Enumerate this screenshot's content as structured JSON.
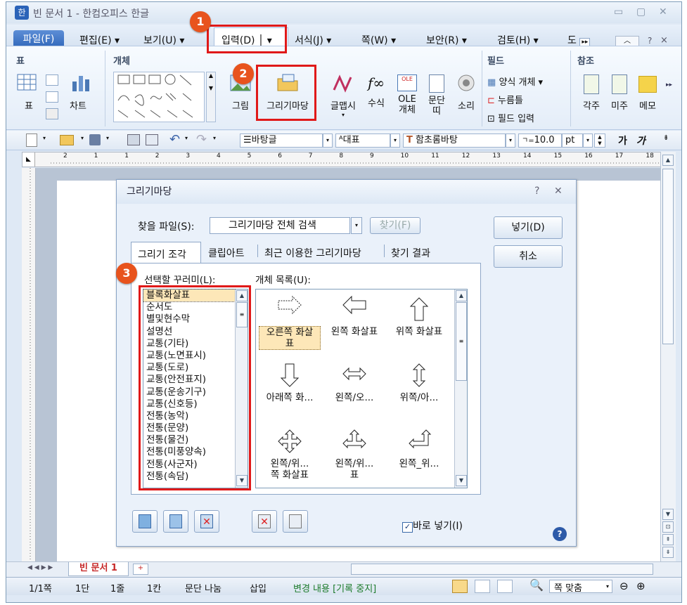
{
  "window": {
    "title": "빈 문서 1 - 한컴오피스 한글",
    "app_icon": "한",
    "min": "▭",
    "max": "▢",
    "close": "✕"
  },
  "menus": [
    "파일(F)",
    "편집(E)",
    "보기(U)",
    "입력(D)",
    "서식(J)",
    "쪽(W)",
    "보안(R)",
    "검토(H)",
    "도"
  ],
  "menu_extra": {
    "help": "?",
    "close": "×"
  },
  "ribbon": {
    "groups": {
      "table": "표",
      "object": "개체",
      "field": "필드",
      "ref": "참조"
    },
    "buttons": {
      "table": "표",
      "chart": "차트",
      "picture": "그림",
      "gallery": "그리기마당",
      "textart": "글맵시",
      "equation": "수식",
      "ole": "OLE\n개체",
      "char": "문단\n띠",
      "sound": "소리",
      "form": "양식 개체",
      "clickhere": "누름틀",
      "fieldinput": "필드 입력",
      "footnote": "각주",
      "endnote": "미주",
      "memo": "메모"
    }
  },
  "toolbar2": {
    "style": "바탕글",
    "langstyle": "대표",
    "font": "함초롬바탕",
    "size": "10.0",
    "unit": "pt",
    "bold": "가",
    "italic": "가"
  },
  "ruler_marks": [
    "2",
    "1",
    "1",
    "2",
    "3",
    "4",
    "5",
    "6",
    "7",
    "8",
    "9",
    "10",
    "11",
    "12",
    "13",
    "14",
    "15",
    "16",
    "17",
    "18"
  ],
  "dialog": {
    "title": "그리기마당",
    "help": "?",
    "close": "✕",
    "find_label": "찾을 파일(S):",
    "find_value": "그리기마당 전체 검색",
    "find_button": "찾기(F)",
    "insert_button": "넣기(D)",
    "cancel_button": "취소",
    "tabs": [
      "그리기 조각",
      "클립아트",
      "최근 이용한 그리기마당",
      "찾기 결과"
    ],
    "category_label": "선택할 꾸러미(L):",
    "objects_label": "개체 목록(U):",
    "categories": [
      "블록화살표",
      "순서도",
      "별및현수막",
      "설명선",
      "교통(기타)",
      "교통(노면표시)",
      "교통(도로)",
      "교통(안전표지)",
      "교통(운송기구)",
      "교통(신호등)",
      "전통(농악)",
      "전통(문양)",
      "전통(물건)",
      "전통(미풍양속)",
      "전통(사군자)",
      "전통(속담)"
    ],
    "objects": [
      {
        "label": "오른쪽 화살\n표",
        "icon": "right-arrow-icon"
      },
      {
        "label": "왼쪽 화살표",
        "icon": "left-arrow-icon"
      },
      {
        "label": "위쪽 화살표",
        "icon": "up-arrow-icon"
      },
      {
        "label": "아래쪽 화...",
        "icon": "down-arrow-icon"
      },
      {
        "label": "왼쪽/오...",
        "icon": "left-right-arrow-icon"
      },
      {
        "label": "위쪽/아...",
        "icon": "up-down-arrow-icon"
      },
      {
        "label": "왼쪽/위...\n쪽 화살표",
        "icon": "quad-arrow-icon"
      },
      {
        "label": "왼쪽/위...\n표",
        "icon": "left-right-up-arrow-icon"
      },
      {
        "label": "왼쪽_위...",
        "icon": "left-up-arrow-icon"
      }
    ],
    "direct_insert": "바로 넣기(I)"
  },
  "annotations": [
    "1",
    "2",
    "3"
  ],
  "doc_tab": "빈 문서 1",
  "status": {
    "page": "1/1쪽",
    "col": "1단",
    "line": "1줄",
    "char": "1칸",
    "para": "문단 나눔",
    "mode": "삽입",
    "track": "변경 내용 [기록 중지]",
    "zoom": "쪽 맞춤"
  }
}
